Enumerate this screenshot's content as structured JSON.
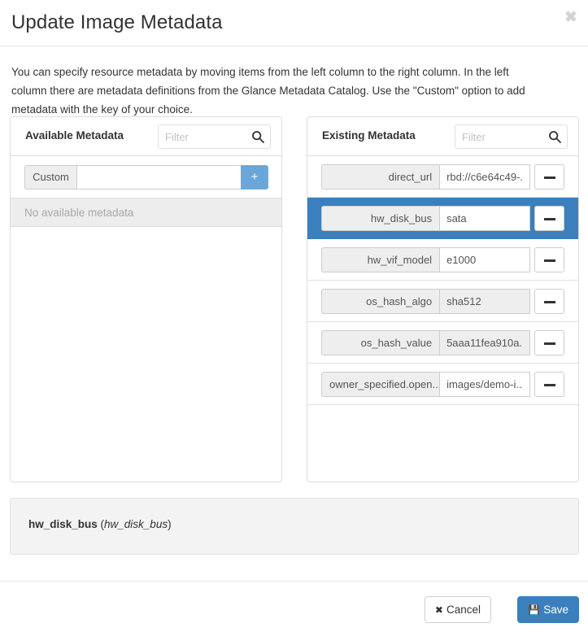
{
  "modal": {
    "title": "Update Image Metadata",
    "close_icon": "close-icon",
    "intro": "You can specify resource metadata by moving items from the left column to the right column. In the left column there are metadata definitions from the Glance Metadata Catalog. Use the \"Custom\" option to add metadata with the key of your choice."
  },
  "available_panel": {
    "title": "Available Metadata",
    "filter_placeholder": "Filter",
    "filter_value": "",
    "search_icon": "search-icon",
    "custom_label": "Custom",
    "custom_value": "",
    "custom_placeholder": "",
    "add_icon": "plus-icon",
    "empty_message": "No available metadata"
  },
  "existing_panel": {
    "title": "Existing Metadata",
    "filter_placeholder": "Filter",
    "filter_value": "",
    "search_icon": "search-icon",
    "remove_icon": "minus-icon",
    "rows": [
      {
        "key": "direct_url",
        "value": "rbd://c6e64c49-...",
        "value_disabled": false,
        "selected": false
      },
      {
        "key": "hw_disk_bus",
        "value": "sata",
        "value_disabled": false,
        "selected": true
      },
      {
        "key": "hw_vif_model",
        "value": "e1000",
        "value_disabled": false,
        "selected": false
      },
      {
        "key": "os_hash_algo",
        "value": "sha512",
        "value_disabled": true,
        "selected": false
      },
      {
        "key": "os_hash_value",
        "value": "5aaa11fea910a...",
        "value_disabled": true,
        "selected": false
      },
      {
        "key": "owner_specified.open...",
        "value": "images/demo-i...",
        "value_disabled": false,
        "selected": false
      }
    ]
  },
  "description": {
    "name": "hw_disk_bus",
    "key_open": " (",
    "key": "hw_disk_bus",
    "key_close": ")"
  },
  "footer": {
    "cancel_label": "Cancel",
    "cancel_icon": "x-icon",
    "save_label": "Save",
    "save_icon": "floppy-disk-icon"
  },
  "colors": {
    "accent_blue": "#3c7fbd",
    "add_button_blue": "#6aa7d8",
    "panel_border": "#dddddd",
    "field_gray": "#eeeeee"
  }
}
